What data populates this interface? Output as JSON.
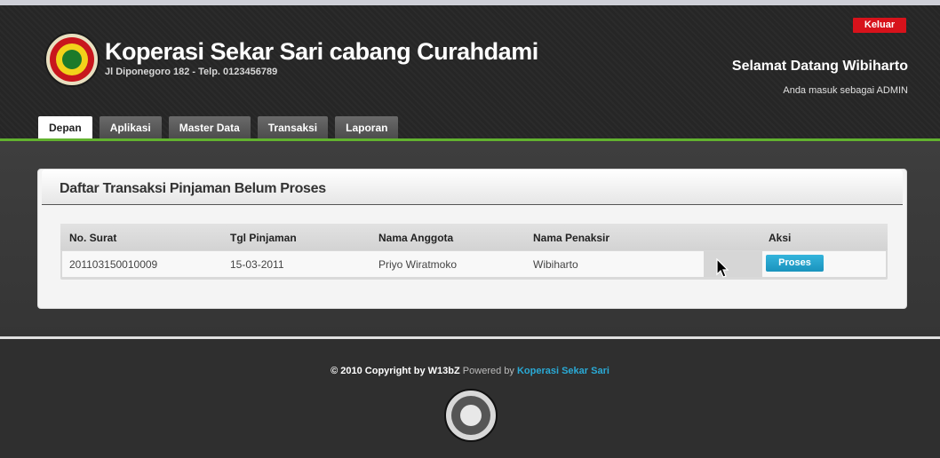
{
  "header": {
    "title": "Koperasi Sekar Sari cabang Curahdami",
    "address": "Jl Diponegoro 182 - Telp. 0123456789",
    "logout_label": "Keluar",
    "welcome": "Selamat Datang Wibiharto",
    "role_text": "Anda masuk sebagai ADMIN"
  },
  "nav": {
    "tabs": [
      {
        "label": "Depan",
        "active": true
      },
      {
        "label": "Aplikasi"
      },
      {
        "label": "Master Data"
      },
      {
        "label": "Transaksi"
      },
      {
        "label": "Laporan"
      }
    ]
  },
  "panel": {
    "title": "Daftar Transaksi Pinjaman Belum Proses",
    "columns": [
      "No. Surat",
      "Tgl Pinjaman",
      "Nama Anggota",
      "Nama Penaksir",
      "Aksi"
    ],
    "rows": [
      {
        "no_surat": "201103150010009",
        "tgl_pinjaman": "15-03-2011",
        "nama_anggota": "Priyo Wiratmoko",
        "nama_penaksir": "Wibiharto",
        "action_label": "Proses"
      }
    ]
  },
  "footer": {
    "copyright": "© 2010 Copyright by W13bZ",
    "powered_by": "Powered by",
    "brand": "Koperasi Sekar Sari"
  },
  "colors": {
    "accent_green": "#62b22f",
    "logout_red": "#d7121b",
    "action_blue": "#1a93bd",
    "link_blue": "#2aaad6"
  },
  "icons": [
    "logo-emblem-icon",
    "mouse-cursor-icon",
    "footer-logo-icon"
  ]
}
